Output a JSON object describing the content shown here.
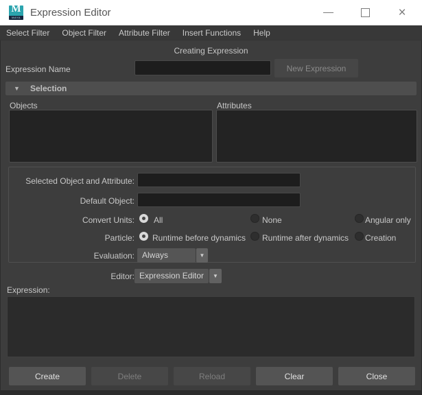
{
  "window": {
    "title": "Expression Editor",
    "icon_letter": "M",
    "icon_caption": "MAYA",
    "controls": {
      "close_glyph": "×"
    }
  },
  "menu": {
    "items": [
      "Select Filter",
      "Object Filter",
      "Attribute Filter",
      "Insert Functions",
      "Help"
    ]
  },
  "status": "Creating Expression",
  "expression_name": {
    "label": "Expression Name",
    "value": "",
    "button_label": "New Expression",
    "button_enabled": false
  },
  "selection": {
    "header": "Selection",
    "collapse_icon": "▼",
    "objects_label": "Objects",
    "attributes_label": "Attributes",
    "objects": [],
    "attributes": []
  },
  "details": {
    "selected_object_attribute": {
      "label": "Selected Object and Attribute:",
      "value": ""
    },
    "default_object": {
      "label": "Default Object:",
      "value": ""
    },
    "convert_units": {
      "label": "Convert Units:",
      "options": [
        {
          "label": "All",
          "selected": true
        },
        {
          "label": "None",
          "selected": false
        },
        {
          "label": "Angular only",
          "selected": false
        }
      ]
    },
    "particle": {
      "label": "Particle:",
      "options": [
        {
          "label": "Runtime before dynamics",
          "selected": true
        },
        {
          "label": "Runtime after dynamics",
          "selected": false
        },
        {
          "label": "Creation",
          "selected": false
        }
      ]
    },
    "evaluation": {
      "label": "Evaluation:",
      "value": "Always",
      "dropdown_icon": "▼"
    },
    "editor": {
      "label": "Editor:",
      "value": "Expression Editor",
      "dropdown_icon": "▼"
    }
  },
  "expression": {
    "label": "Expression:",
    "value": ""
  },
  "footer": {
    "buttons": [
      {
        "label": "Create",
        "enabled": true
      },
      {
        "label": "Delete",
        "enabled": false
      },
      {
        "label": "Reload",
        "enabled": false
      },
      {
        "label": "Clear",
        "enabled": true
      },
      {
        "label": "Close",
        "enabled": true
      }
    ]
  },
  "colors": {
    "maya_teal": "#2ba4ae",
    "titlebar_bg": "#ffffff",
    "window_bg": "#3d3d3d",
    "panel_header_bg": "#4e4e4e",
    "field_bg": "#1d1d1d",
    "textarea_bg": "#2b2b2b"
  }
}
